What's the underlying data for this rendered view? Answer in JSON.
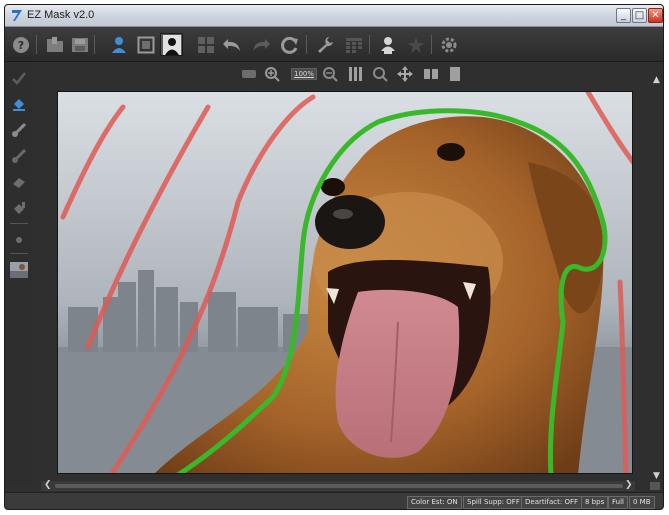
{
  "window": {
    "title": "EZ Mask v2.0",
    "buttons": {
      "minimize": "_",
      "maximize": "□",
      "close": "✕"
    }
  },
  "toolbar": {
    "items": [
      {
        "name": "help-icon"
      },
      {
        "name": "open-icon"
      },
      {
        "name": "save-icon"
      },
      {
        "name": "person-icon"
      },
      {
        "name": "frame-icon"
      },
      {
        "name": "silhouette-icon"
      },
      {
        "name": "grid-icon"
      },
      {
        "name": "undo-icon"
      },
      {
        "name": "redo-icon"
      },
      {
        "name": "refresh-icon"
      },
      {
        "name": "wrench-icon"
      },
      {
        "name": "calendar-icon"
      },
      {
        "name": "person-check-icon"
      },
      {
        "name": "star-icon"
      },
      {
        "name": "settings-icon"
      }
    ]
  },
  "left_tools": [
    {
      "name": "checkmark-brush-icon"
    },
    {
      "name": "fill-bucket-icon"
    },
    {
      "name": "keep-brush-icon"
    },
    {
      "name": "drop-brush-icon"
    },
    {
      "name": "eraser-icon"
    },
    {
      "name": "fill-tool-icon"
    },
    {
      "name": "dot-tool-icon"
    },
    {
      "name": "image-preview-icon"
    }
  ],
  "view_toolbar": {
    "zoom_label": "100%",
    "items": [
      {
        "name": "fit-view-icon"
      },
      {
        "name": "zoom-in-icon"
      },
      {
        "name": "zoom-out-icon"
      },
      {
        "name": "columns-icon"
      },
      {
        "name": "search-icon"
      },
      {
        "name": "pan-icon"
      },
      {
        "name": "split-view-icon"
      },
      {
        "name": "single-view-icon"
      }
    ]
  },
  "canvas": {
    "keep_color": "#39b82a",
    "drop_color": "#e05a55"
  },
  "statusbar": {
    "color_est": "Color Est: ON",
    "spill_supp": "Spill Supp: OFF",
    "deartifact": "Deartifact: OFF",
    "bps": "8 bps",
    "view": "Full",
    "memory": "0 MB"
  },
  "colors": {
    "chrome_dark": "#2f2f2f",
    "titlebar": "#cfd5de"
  }
}
